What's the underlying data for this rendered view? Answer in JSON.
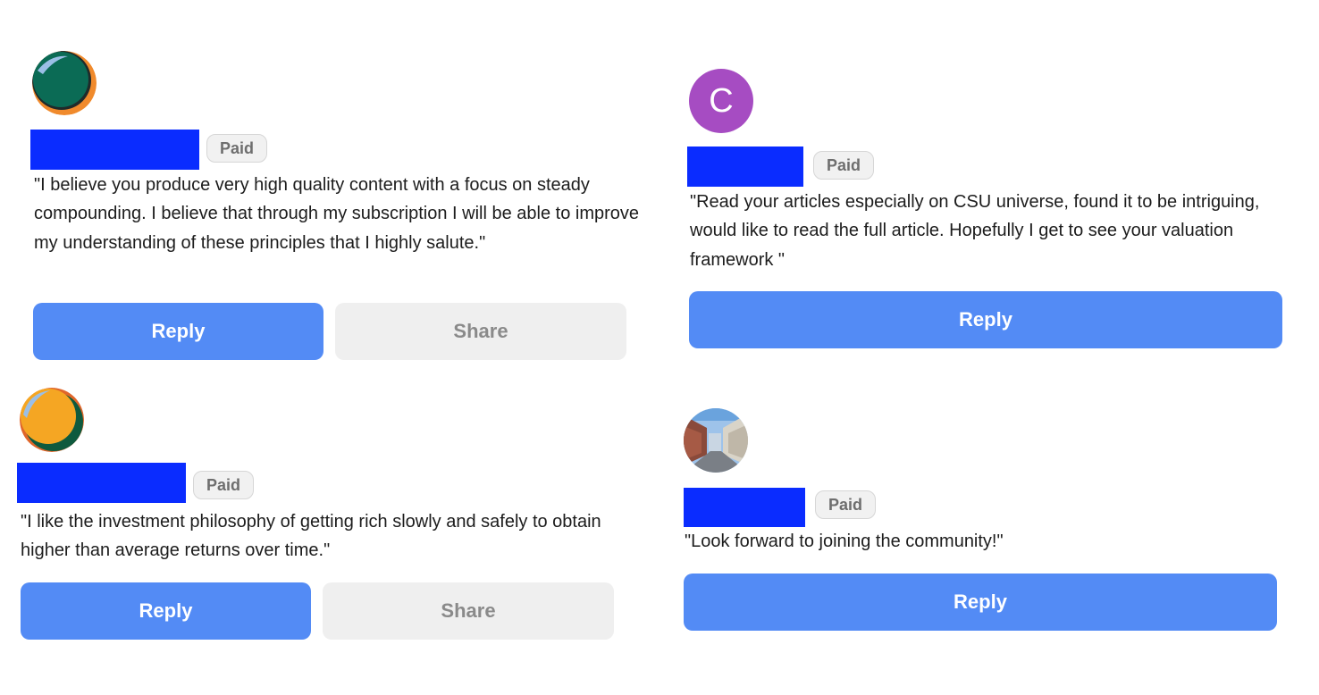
{
  "comments": [
    {
      "badge": "Paid",
      "text": "\"I believe you produce very high quality content with a focus on steady compounding. I believe that through my subscription I will be able to improve my understanding of these principles that I highly salute.\"",
      "reply_label": "Reply",
      "share_label": "Share",
      "avatar": "green-orange-circle-avatar"
    },
    {
      "avatar_letter": "C",
      "avatar_color": "#a64cc2",
      "badge": "Paid",
      "text": "\"Read your articles especially on CSU universe, found it to be intriguing, would like to read the full article. Hopefully I get to see your valuation framework \"",
      "reply_label": "Reply"
    },
    {
      "badge": "Paid",
      "text": "\"I like the investment philosophy of getting rich slowly and safely to obtain higher than average returns over time.\"",
      "reply_label": "Reply",
      "share_label": "Share",
      "avatar": "yellow-green-circle-avatar"
    },
    {
      "badge": "Paid",
      "text": "\"Look forward to joining the community!\"",
      "reply_label": "Reply",
      "avatar": "street-photo-avatar"
    }
  ],
  "colors": {
    "reply_button": "#538bf5",
    "share_button": "#efefef",
    "name_redaction": "#0a2cff",
    "badge_background": "#f1f1f1"
  }
}
